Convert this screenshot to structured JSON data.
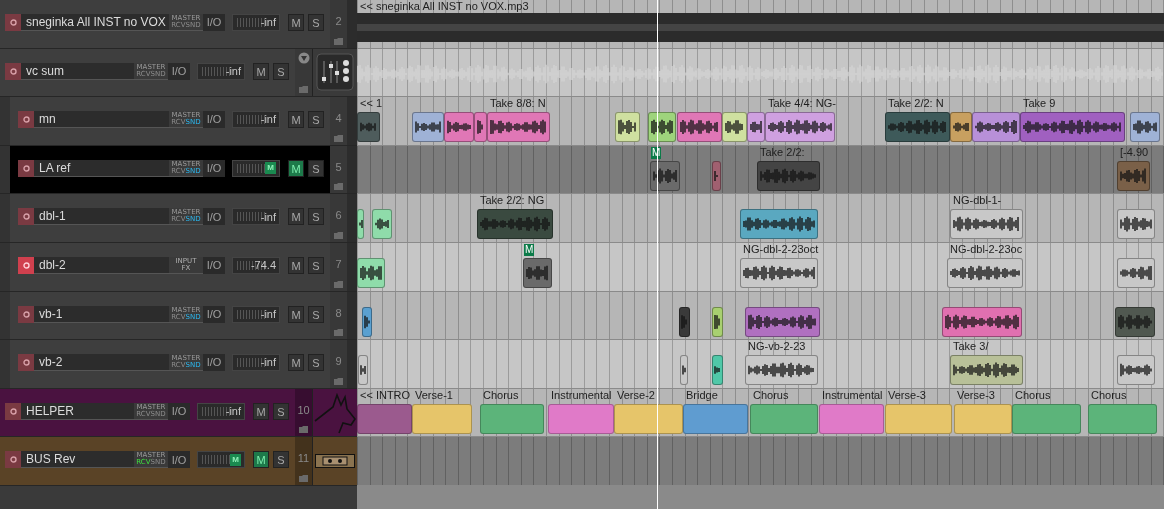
{
  "tracks": [
    {
      "name": "sneginka All INST no VOX",
      "number": "2",
      "armed": false,
      "selected": false,
      "route": {
        "kind": "master",
        "top": "MASTER",
        "rcv": "RCV",
        "snd": "SND",
        "rcv_active": false,
        "snd_active": false
      },
      "io": "I/O",
      "meter": {
        "reading": "-inf",
        "muted": false
      },
      "mute": {
        "label": "M",
        "on": false
      },
      "solo": {
        "label": "S",
        "on": false
      },
      "clips": [
        {
          "kind": "bar",
          "label": "<< sneginka All INST no VOX.mp3",
          "color": "#2b2b2b"
        }
      ]
    },
    {
      "name": "vc sum",
      "armed": false,
      "selected": false,
      "expanded": true,
      "route": {
        "kind": "master",
        "top": "MASTER",
        "rcv": "RCV",
        "snd": "SND",
        "rcv_active": false,
        "snd_active": false
      },
      "io": "I/O",
      "meter": {
        "reading": "-inf",
        "muted": false
      },
      "mute": {
        "label": "M",
        "on": false
      },
      "solo": {
        "label": "S",
        "on": false
      },
      "clips": [
        {
          "kind": "ghost",
          "color": "#d4d4d4"
        }
      ],
      "children": [
        {
          "name": "mn",
          "number": "4",
          "armed": false,
          "selected": false,
          "route": {
            "kind": "master",
            "top": "MASTER",
            "rcv": "RCV",
            "snd": "SND",
            "rcv_active": false,
            "snd_active": true
          },
          "io": "I/O",
          "meter": {
            "reading": "-inf",
            "muted": false
          },
          "mute": {
            "label": "M",
            "on": false
          },
          "solo": {
            "label": "S",
            "on": false
          },
          "clips": [
            {
              "kind": "audio",
              "label": "<< 1",
              "color": "#4e5c5c"
            },
            {
              "kind": "audio",
              "color": "#9fb2d6"
            },
            {
              "kind": "audio",
              "color": "#e077b6"
            },
            {
              "kind": "audio",
              "color": "#e077b6"
            },
            {
              "kind": "audio",
              "label": "Take 8/8: N",
              "color": "#e077b6"
            },
            {
              "kind": "audio",
              "color": "#cfe0a0"
            },
            {
              "kind": "audio",
              "color": "#9ed47c"
            },
            {
              "kind": "audio",
              "color": "#e077b6"
            },
            {
              "kind": "audio",
              "color": "#cfe0a0"
            },
            {
              "kind": "audio",
              "color": "#cfa0e0"
            },
            {
              "kind": "audio",
              "label": "Take 4/4: NG-",
              "color": "#cfa0e0"
            },
            {
              "kind": "audio",
              "label": "Take 2/2: N",
              "color": "#3e5a5a"
            },
            {
              "kind": "audio",
              "color": "#c8a060"
            },
            {
              "kind": "audio",
              "color": "#b890d8"
            },
            {
              "kind": "audio",
              "label": "Take 9",
              "color": "#a060c0"
            },
            {
              "kind": "audio",
              "color": "#9fb2d6"
            }
          ]
        },
        {
          "name": "LA ref",
          "number": "5",
          "armed": false,
          "selected": true,
          "route": {
            "kind": "master",
            "top": "MASTER",
            "rcv": "RCV",
            "snd": "SND",
            "rcv_active": false,
            "snd_active": true
          },
          "io": "I/O",
          "meter": {
            "reading": "M",
            "muted": true
          },
          "mute": {
            "label": "M",
            "on": true
          },
          "solo": {
            "label": "S",
            "on": false
          },
          "clips": [
            {
              "kind": "audio",
              "badge": "M",
              "color": "#6a6a6a"
            },
            {
              "kind": "audio",
              "color": "#a06070"
            },
            {
              "kind": "audio",
              "label": "Take 2/2:",
              "color": "#444444"
            },
            {
              "kind": "audio",
              "label": "[-4.90",
              "color": "#7a6048"
            }
          ]
        },
        {
          "name": "dbl-1",
          "number": "6",
          "armed": false,
          "selected": false,
          "route": {
            "kind": "master",
            "top": "MASTER",
            "rcv": "RCV",
            "snd": "SND",
            "rcv_active": false,
            "snd_active": true
          },
          "io": "I/O",
          "meter": {
            "reading": "-inf",
            "muted": false
          },
          "mute": {
            "label": "M",
            "on": false
          },
          "solo": {
            "label": "S",
            "on": false
          },
          "clips": [
            {
              "kind": "audio",
              "color": "#8fdcaa"
            },
            {
              "kind": "audio",
              "color": "#8fdcaa"
            },
            {
              "kind": "audio",
              "label": "Take 2/2: NG",
              "color": "#3a4a40"
            },
            {
              "kind": "audio",
              "color": "#5aa8c0"
            },
            {
              "kind": "audio",
              "label": "NG-dbl-1-",
              "color": "#c8c8c8"
            },
            {
              "kind": "audio",
              "color": "#c8c8c8"
            }
          ]
        },
        {
          "name": "dbl-2",
          "number": "7",
          "armed": true,
          "selected": false,
          "route": {
            "kind": "input_fx",
            "top": "INPUT",
            "bottom": "FX"
          },
          "io": "I/O",
          "meter": {
            "reading": "-74.4",
            "muted": false
          },
          "mute": {
            "label": "M",
            "on": false
          },
          "solo": {
            "label": "S",
            "on": false
          },
          "clips": [
            {
              "kind": "audio",
              "color": "#8fdcaa"
            },
            {
              "kind": "audio",
              "badge": "M",
              "color": "#6a6a6a"
            },
            {
              "kind": "audio",
              "label": "NG-dbl-2-23oct",
              "color": "#c8c8c8"
            },
            {
              "kind": "audio",
              "label": "NG-dbl-2-23oc",
              "color": "#c8c8c8"
            },
            {
              "kind": "audio",
              "color": "#c8c8c8"
            }
          ]
        },
        {
          "name": "vb-1",
          "number": "8",
          "armed": false,
          "selected": false,
          "route": {
            "kind": "master",
            "top": "MASTER",
            "rcv": "RCV",
            "snd": "SND",
            "rcv_active": false,
            "snd_active": true
          },
          "io": "I/O",
          "meter": {
            "reading": "-inf",
            "muted": false
          },
          "mute": {
            "label": "M",
            "on": false
          },
          "solo": {
            "label": "S",
            "on": false
          },
          "clips": [
            {
              "kind": "audio",
              "color": "#5aa0d0"
            },
            {
              "kind": "audio",
              "color": "#3a3a3a"
            },
            {
              "kind": "audio",
              "color": "#a8d070"
            },
            {
              "kind": "audio",
              "color": "#b070c0"
            },
            {
              "kind": "audio",
              "color": "#e070b0"
            },
            {
              "kind": "audio",
              "color": "#505850"
            }
          ]
        },
        {
          "name": "vb-2",
          "number": "9",
          "armed": false,
          "selected": false,
          "route": {
            "kind": "master",
            "top": "MASTER",
            "rcv": "RCV",
            "snd": "SND",
            "rcv_active": false,
            "snd_active": true
          },
          "io": "I/O",
          "meter": {
            "reading": "-inf",
            "muted": false
          },
          "mute": {
            "label": "M",
            "on": false
          },
          "solo": {
            "label": "S",
            "on": false
          },
          "clips": [
            {
              "kind": "audio",
              "color": "#c8c8c8"
            },
            {
              "kind": "audio",
              "color": "#c8c8c8"
            },
            {
              "kind": "audio",
              "color": "#50c8a8"
            },
            {
              "kind": "audio",
              "label": "NG-vb-2-23",
              "color": "#c8c8c8"
            },
            {
              "kind": "audio",
              "label": "Take 3/",
              "color": "#b8c098"
            },
            {
              "kind": "audio",
              "color": "#c8c8c8"
            }
          ]
        }
      ]
    },
    {
      "name": "HELPER",
      "number": "10",
      "armed": false,
      "selected": false,
      "color": "#4a1240",
      "route": {
        "kind": "master",
        "top": "MASTER",
        "rcv": "RCV",
        "snd": "SND",
        "rcv_active": false,
        "snd_active": false
      },
      "io": "I/O",
      "meter": {
        "reading": "-inf",
        "muted": false
      },
      "mute": {
        "label": "M",
        "on": false
      },
      "solo": {
        "label": "S",
        "on": false
      },
      "clips": [
        {
          "kind": "region",
          "label": "<< INTRO",
          "color": "#9b5a8e"
        },
        {
          "kind": "region",
          "label": "Verse-1",
          "color": "#e6c56a"
        },
        {
          "kind": "region",
          "label": "Chorus",
          "color": "#5cb47a"
        },
        {
          "kind": "region",
          "label": "Instrumental",
          "color": "#e07ac8"
        },
        {
          "kind": "region",
          "label": "Verse-2",
          "color": "#e6c56a"
        },
        {
          "kind": "region",
          "label": "Bridge",
          "color": "#5f9cd0"
        },
        {
          "kind": "region",
          "label": "Chorus",
          "color": "#5cb47a"
        },
        {
          "kind": "region",
          "label": "Instrumental",
          "color": "#e07ac8"
        },
        {
          "kind": "region",
          "label": "Verse-3",
          "color": "#e6c56a"
        },
        {
          "kind": "region",
          "label": "Verse-3",
          "color": "#e6c56a"
        },
        {
          "kind": "region",
          "label": "Chorus",
          "color": "#5cb47a"
        },
        {
          "kind": "region",
          "label": "Chorus",
          "color": "#5cb47a"
        }
      ]
    },
    {
      "name": "BUS Rev",
      "number": "11",
      "armed": false,
      "selected": false,
      "color": "#5a4326",
      "route": {
        "kind": "master",
        "top": "MASTER",
        "rcv": "RCV",
        "snd": "SND",
        "rcv_active": true,
        "snd_active": false
      },
      "io": "I/O",
      "meter": {
        "reading": "M",
        "muted": true
      },
      "mute": {
        "label": "M",
        "on": true
      },
      "solo": {
        "label": "S",
        "on": false
      }
    }
  ]
}
